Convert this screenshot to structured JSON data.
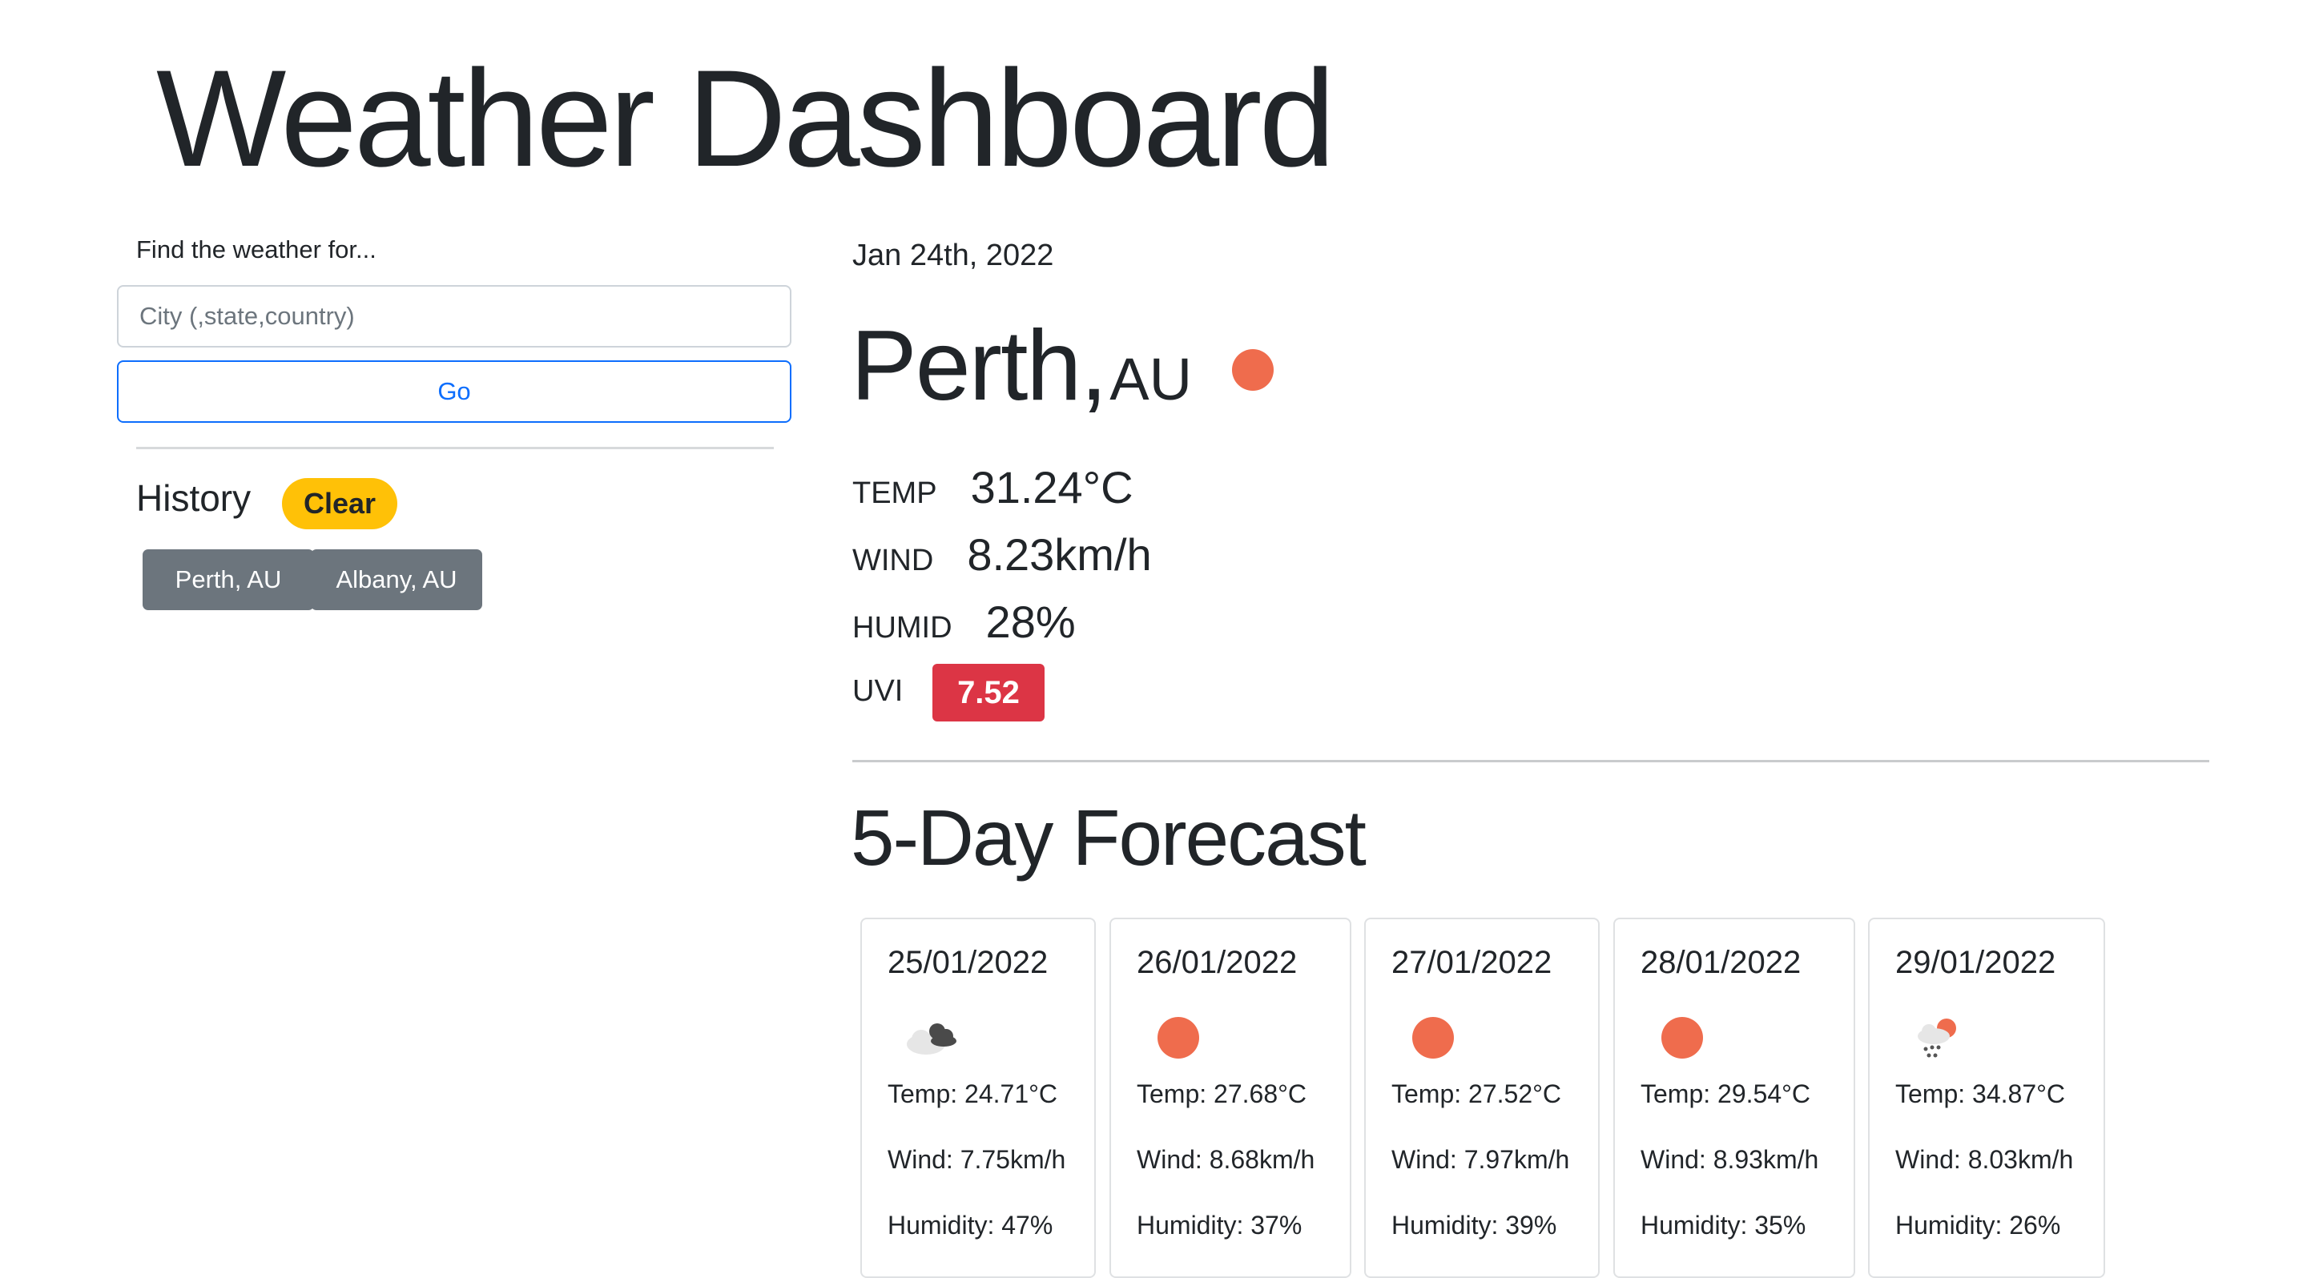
{
  "header": {
    "title": "Weather Dashboard"
  },
  "search": {
    "label": "Find the weather for...",
    "placeholder": "City (,state,country)",
    "value": "",
    "go_label": "Go"
  },
  "history": {
    "heading": "History",
    "clear_label": "Clear",
    "items": [
      {
        "label": "Perth, AU"
      },
      {
        "label": "Albany, AU"
      }
    ]
  },
  "current": {
    "date": "Jan 24th, 2022",
    "city": "Perth,",
    "country": "AU",
    "icon": "sun-icon",
    "temp_label": "TEMP",
    "temp": "31.24°C",
    "wind_label": "WIND",
    "wind": "8.23km/h",
    "humid_label": "HUMID",
    "humid": "28%",
    "uvi_label": "UVI",
    "uvi": "7.52",
    "uvi_color": "#dc3545"
  },
  "forecast": {
    "heading": "5-Day Forecast",
    "days": [
      {
        "date": "25/01/2022",
        "icon": "cloud-icon",
        "temp": "Temp: 24.71°C",
        "wind": "Wind: 7.75km/h",
        "humidity": "Humidity: 47%"
      },
      {
        "date": "26/01/2022",
        "icon": "sun-icon",
        "temp": "Temp: 27.68°C",
        "wind": "Wind: 8.68km/h",
        "humidity": "Humidity: 37%"
      },
      {
        "date": "27/01/2022",
        "icon": "sun-icon",
        "temp": "Temp: 27.52°C",
        "wind": "Wind: 7.97km/h",
        "humidity": "Humidity: 39%"
      },
      {
        "date": "28/01/2022",
        "icon": "sun-icon",
        "temp": "Temp: 29.54°C",
        "wind": "Wind: 8.93km/h",
        "humidity": "Humidity: 35%"
      },
      {
        "date": "29/01/2022",
        "icon": "rain-sun-icon",
        "temp": "Temp: 34.87°C",
        "wind": "Wind: 8.03km/h",
        "humidity": "Humidity: 26%"
      }
    ]
  },
  "colors": {
    "accent": "#0d6efd",
    "warning": "#ffc107",
    "secondary": "#6c757d",
    "sun": "#ef6c4d"
  }
}
